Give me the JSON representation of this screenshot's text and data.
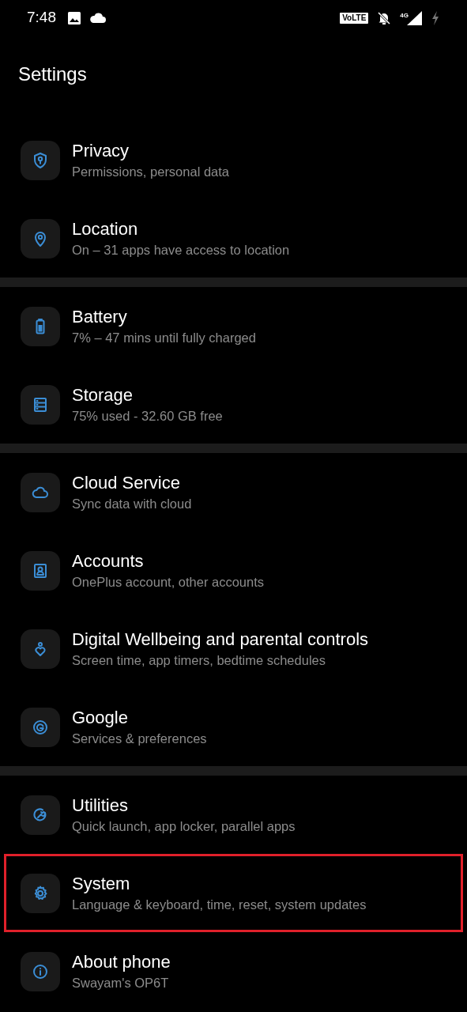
{
  "status_bar": {
    "time": "7:48",
    "volte": "VoLTE",
    "network": "4G"
  },
  "title": "Settings",
  "groups": [
    {
      "items": [
        {
          "kind": "shield",
          "title": "Privacy",
          "subtitle": "Permissions, personal data",
          "highlighted": false
        },
        {
          "kind": "pin",
          "title": "Location",
          "subtitle": "On – 31 apps have access to location",
          "highlighted": false
        }
      ]
    },
    {
      "items": [
        {
          "kind": "battery",
          "title": "Battery",
          "subtitle": "7% – 47 mins until fully charged",
          "highlighted": false
        },
        {
          "kind": "storage",
          "title": "Storage",
          "subtitle": "75% used - 32.60 GB free",
          "highlighted": false
        }
      ]
    },
    {
      "items": [
        {
          "kind": "cloud",
          "title": "Cloud Service",
          "subtitle": "Sync data with cloud",
          "highlighted": false
        },
        {
          "kind": "account",
          "title": "Accounts",
          "subtitle": "OnePlus account, other accounts",
          "highlighted": false
        },
        {
          "kind": "wellbeing",
          "title": "Digital Wellbeing and parental controls",
          "subtitle": "Screen time, app timers, bedtime schedules",
          "highlighted": false
        },
        {
          "kind": "google",
          "title": "Google",
          "subtitle": "Services & preferences",
          "highlighted": false
        }
      ]
    },
    {
      "items": [
        {
          "kind": "utilities",
          "title": "Utilities",
          "subtitle": "Quick launch, app locker, parallel apps",
          "highlighted": false
        },
        {
          "kind": "gear",
          "title": "System",
          "subtitle": "Language & keyboard, time, reset, system updates",
          "highlighted": true
        },
        {
          "kind": "info",
          "title": "About phone",
          "subtitle": "Swayam's OP6T",
          "highlighted": false
        }
      ]
    }
  ]
}
